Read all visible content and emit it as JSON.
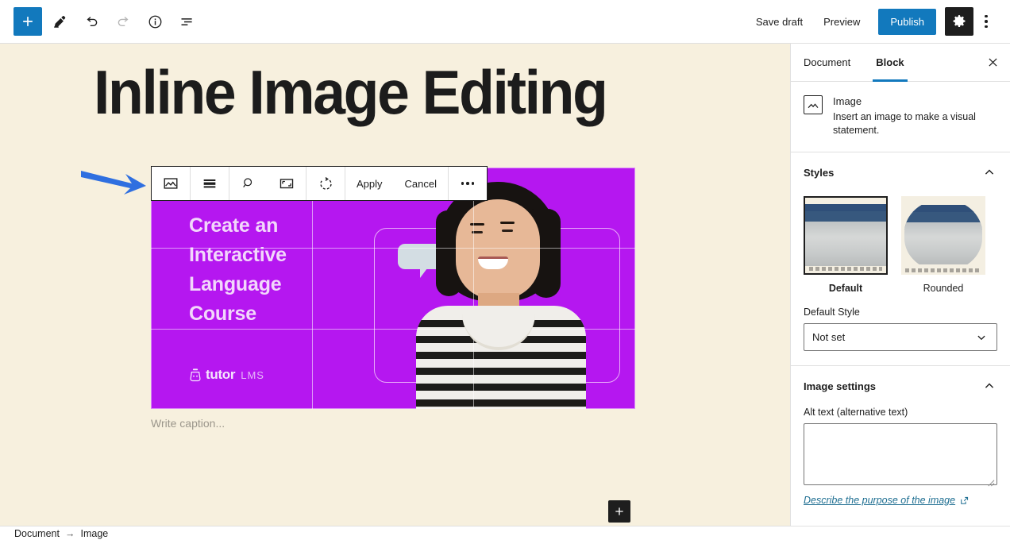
{
  "topbar": {
    "inserter_label": "Add block",
    "tools": [
      {
        "name": "add-block-inserter",
        "label": "Toggle block inserter"
      },
      {
        "name": "edit-tool",
        "label": "Tools"
      },
      {
        "name": "undo",
        "label": "Undo"
      },
      {
        "name": "redo",
        "label": "Redo"
      },
      {
        "name": "details",
        "label": "Details"
      },
      {
        "name": "list-view",
        "label": "List view"
      }
    ],
    "save_draft": "Save draft",
    "preview": "Preview",
    "publish": "Publish",
    "settings_label": "Settings",
    "options_label": "Options"
  },
  "canvas": {
    "post_title": "Inline Image Editing",
    "caption_placeholder": "Write caption...",
    "appender_label": "Add block",
    "background_color": "#f7f0de"
  },
  "image_block": {
    "bg_color": "#b517f0",
    "promo_lines": [
      "Create an",
      "Interactive",
      "Language",
      "Course"
    ],
    "brand_name": "tutor",
    "brand_suffix": "LMS"
  },
  "block_toolbar": {
    "buttons": [
      {
        "name": "image-block-icon",
        "label": "Image"
      },
      {
        "name": "align-icon",
        "label": "Align"
      },
      {
        "name": "zoom-icon",
        "label": "Zoom"
      },
      {
        "name": "aspect-ratio-icon",
        "label": "Aspect ratio"
      },
      {
        "name": "rotate-icon",
        "label": "Rotate"
      }
    ],
    "apply": "Apply",
    "cancel": "Cancel",
    "more_label": "More options"
  },
  "sidebar": {
    "tabs": [
      {
        "label": "Document",
        "active": false
      },
      {
        "label": "Block",
        "active": true
      }
    ],
    "close_label": "Close settings",
    "block_card": {
      "title": "Image",
      "description": "Insert an image to make a visual statement."
    },
    "styles": {
      "title": "Styles",
      "items": [
        {
          "name": "Default",
          "selected": true
        },
        {
          "name": "Rounded",
          "selected": false
        }
      ],
      "default_style_label": "Default Style",
      "default_style_value": "Not set"
    },
    "image_settings": {
      "title": "Image settings",
      "alt_label": "Alt text (alternative text)",
      "alt_value": "",
      "help_link": "Describe the purpose of the image"
    },
    "accent_color": "#1279bd"
  },
  "breadcrumb": {
    "items": [
      "Document",
      "Image"
    ],
    "separator": "→"
  }
}
